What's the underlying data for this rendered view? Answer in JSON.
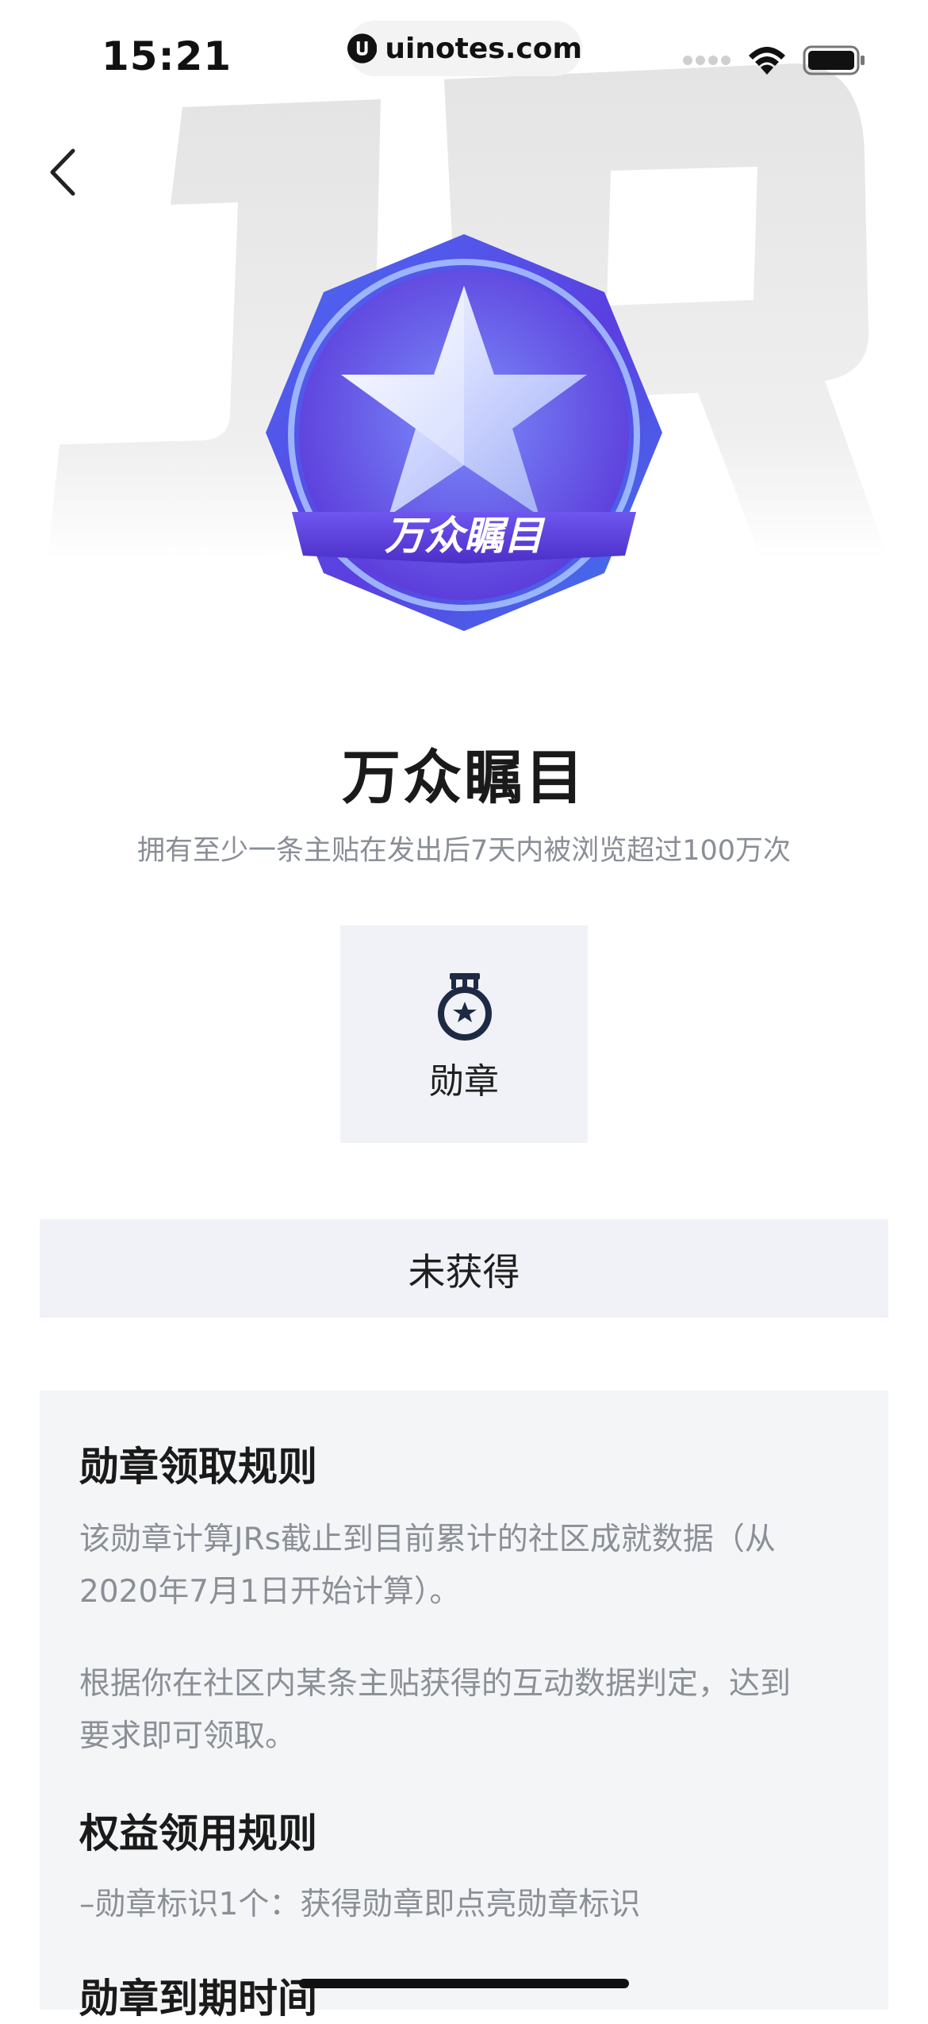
{
  "status_bar": {
    "time": "15:21",
    "url": "uinotes.com"
  },
  "watermark": {
    "text": "JR"
  },
  "badge": {
    "ribbon_text": "万众瞩目"
  },
  "achievement": {
    "title": "万众瞩目",
    "description": "拥有至少一条主贴在发出后7天内被浏览超过100万次"
  },
  "type_card": {
    "icon": "medal-icon",
    "label": "勋章"
  },
  "status": {
    "label": "未获得"
  },
  "rules": {
    "heading_1": "勋章领取规则",
    "para_1_line_1": "该勋章计算JRs截止到目前累计的社区成就数据（从",
    "para_1_line_2": "2020年7月1日开始计算）。",
    "para_2_line_1": "根据你在社区内某条主贴获得的互动数据判定，达到",
    "para_2_line_2": "要求即可领取。",
    "heading_2": "权益领用规则",
    "benefit_1": "–勋章标识1个：获得勋章即点亮勋章标识",
    "heading_3": "勋章到期时间"
  },
  "colors": {
    "badge_purple": "#5b3fe0",
    "badge_blue": "#3d7bf0",
    "panel_bg": "#f4f5f7",
    "muted_text": "#8b8f96"
  }
}
